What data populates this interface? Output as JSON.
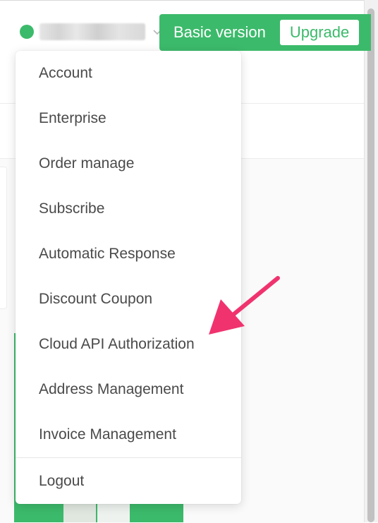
{
  "header": {
    "plan_label": "Basic version",
    "upgrade_label": "Upgrade"
  },
  "user_menu": {
    "items": [
      "Account",
      "Enterprise",
      "Order manage",
      "Subscribe",
      "Automatic Response",
      "Discount Coupon",
      "Cloud API Authorization",
      "Address Management",
      "Invoice Management"
    ],
    "logout_label": "Logout"
  },
  "annotation": {
    "arrow_color": "#f0336f",
    "points_to": "Cloud API Authorization"
  },
  "colors": {
    "brand_green": "#3cba6b",
    "menu_text": "#4a4a4a"
  },
  "icons": {
    "user_avatar": "user-avatar",
    "dropdown_caret": "chevron-down-icon"
  }
}
